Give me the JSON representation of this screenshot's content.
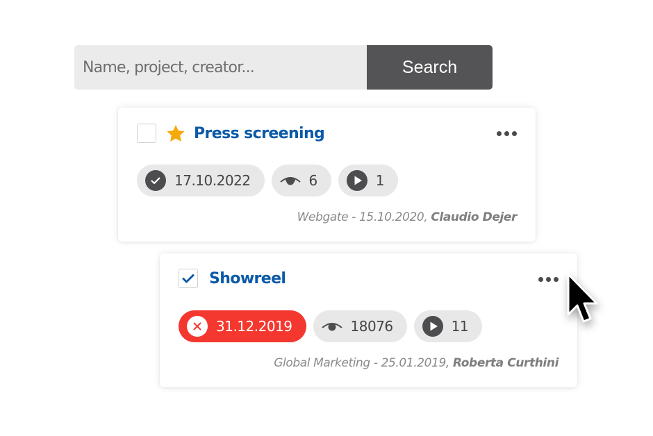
{
  "search": {
    "placeholder": "Name, project, creator...",
    "value": "",
    "button_label": "Search"
  },
  "cards": [
    {
      "title": "Press screening",
      "checked": false,
      "starred": true,
      "star_color": "#f5a90a",
      "status": {
        "icon": "check-circle-icon",
        "date": "17.10.2022",
        "state": "approved"
      },
      "views": "6",
      "plays": "1",
      "meta": {
        "source": "Webgate",
        "separator": " - ",
        "date": "15.10.2020",
        "comma": ", ",
        "creator": "Claudio Dejer"
      }
    },
    {
      "title": "Showreel",
      "checked": true,
      "starred": false,
      "status": {
        "icon": "x-circle-icon",
        "date": "31.12.2019",
        "state": "expired",
        "color": "#f4382f"
      },
      "views": "18076",
      "plays": "11",
      "meta": {
        "source": "Global Marketing",
        "separator": " - ",
        "date": "25.01.2019",
        "comma": ", ",
        "creator": "Roberta Curthini"
      }
    }
  ],
  "colors": {
    "title_blue": "#0b5aa8",
    "search_button": "#545456",
    "pill_bg": "#e8e8e8",
    "expired_red": "#f4382f"
  }
}
